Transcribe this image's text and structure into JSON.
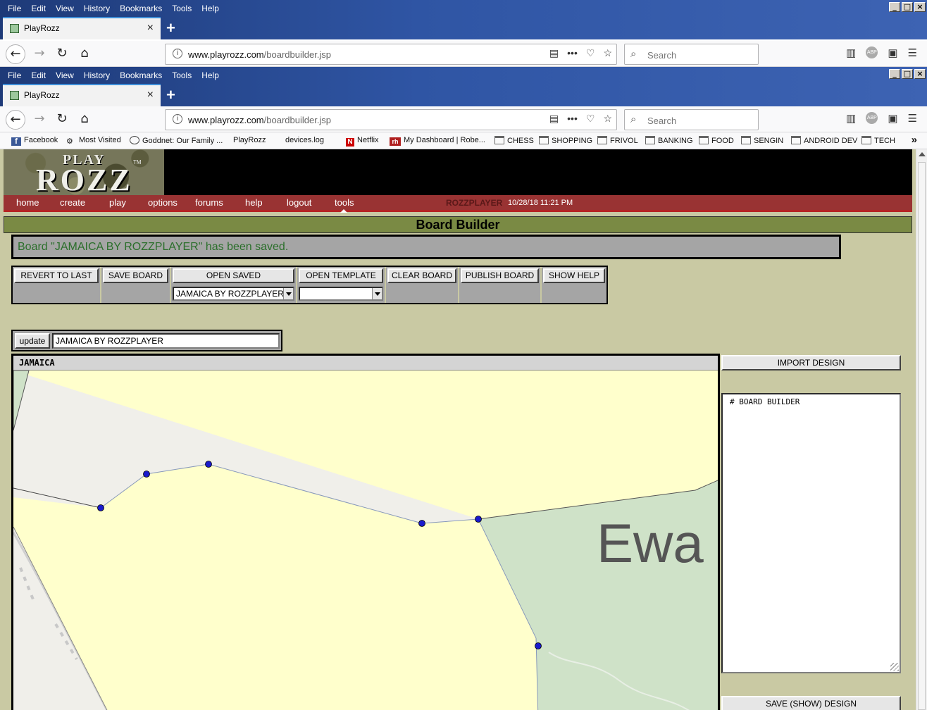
{
  "browser": {
    "menu": [
      "File",
      "Edit",
      "View",
      "History",
      "Bookmarks",
      "Tools",
      "Help"
    ],
    "tab_title": "PlayRozz",
    "url_domain": "www.playrozz.com",
    "url_path": "/boardbuilder.jsp",
    "search_placeholder": "Search",
    "bookmarks": [
      {
        "label": "Facebook",
        "icon": "facebook-icon"
      },
      {
        "label": "Most Visited",
        "icon": "gear-icon"
      },
      {
        "label": "Goddnet: Our Family ...",
        "icon": "globe-icon"
      },
      {
        "label": "PlayRozz",
        "icon": "page-icon"
      },
      {
        "label": "devices.log",
        "icon": "page-icon"
      },
      {
        "label": "Netflix",
        "icon": "netflix-icon"
      },
      {
        "label": "My Dashboard | Robe...",
        "icon": "rh-icon"
      },
      {
        "label": "CHESS",
        "icon": "folder-icon"
      },
      {
        "label": "SHOPPING",
        "icon": "folder-icon"
      },
      {
        "label": "FRIVOL",
        "icon": "folder-icon"
      },
      {
        "label": "BANKING",
        "icon": "folder-icon"
      },
      {
        "label": "FOOD",
        "icon": "folder-icon"
      },
      {
        "label": "SENGIN",
        "icon": "folder-icon"
      },
      {
        "label": "ANDROID DEV",
        "icon": "folder-icon"
      },
      {
        "label": "TECH",
        "icon": "folder-icon"
      }
    ]
  },
  "site": {
    "logo_play": "PLAY",
    "logo_rozz": "ROZZ",
    "logo_tm": "TM",
    "nav": [
      "home",
      "create",
      "play",
      "options",
      "forums",
      "help",
      "logout",
      "tools"
    ],
    "username": "ROZZPLAYER",
    "timestamp": "10/28/18 11:21 PM"
  },
  "builder": {
    "page_title": "Board Builder",
    "message": "Board \"JAMAICA BY ROZZPLAYER\" has been saved.",
    "toolbar": [
      {
        "label": "REVERT TO LAST",
        "select": null
      },
      {
        "label": "SAVE BOARD",
        "select": null
      },
      {
        "label": "OPEN SAVED",
        "select": "JAMAICA BY ROZZPLAYER"
      },
      {
        "label": "OPEN TEMPLATE",
        "select": ""
      },
      {
        "label": "CLEAR BOARD",
        "select": null
      },
      {
        "label": "PUBLISH BOARD",
        "select": null
      },
      {
        "label": "SHOW HELP",
        "select": null
      }
    ],
    "update_label": "update",
    "board_name_value": "JAMAICA BY ROZZPLAYER",
    "board_title": "JAMAICA",
    "map_label": "Ewa",
    "import_label": "IMPORT DESIGN",
    "design_text": "# BOARD BUILDER",
    "save_show_label": "SAVE (SHOW) DESIGN"
  },
  "colors": {
    "region_fill": "#ffffcc",
    "vertex": "#1a1acc",
    "nav_bg": "#993333",
    "title_bar": "#7a8a44",
    "page_bg": "#c9c9a3"
  }
}
